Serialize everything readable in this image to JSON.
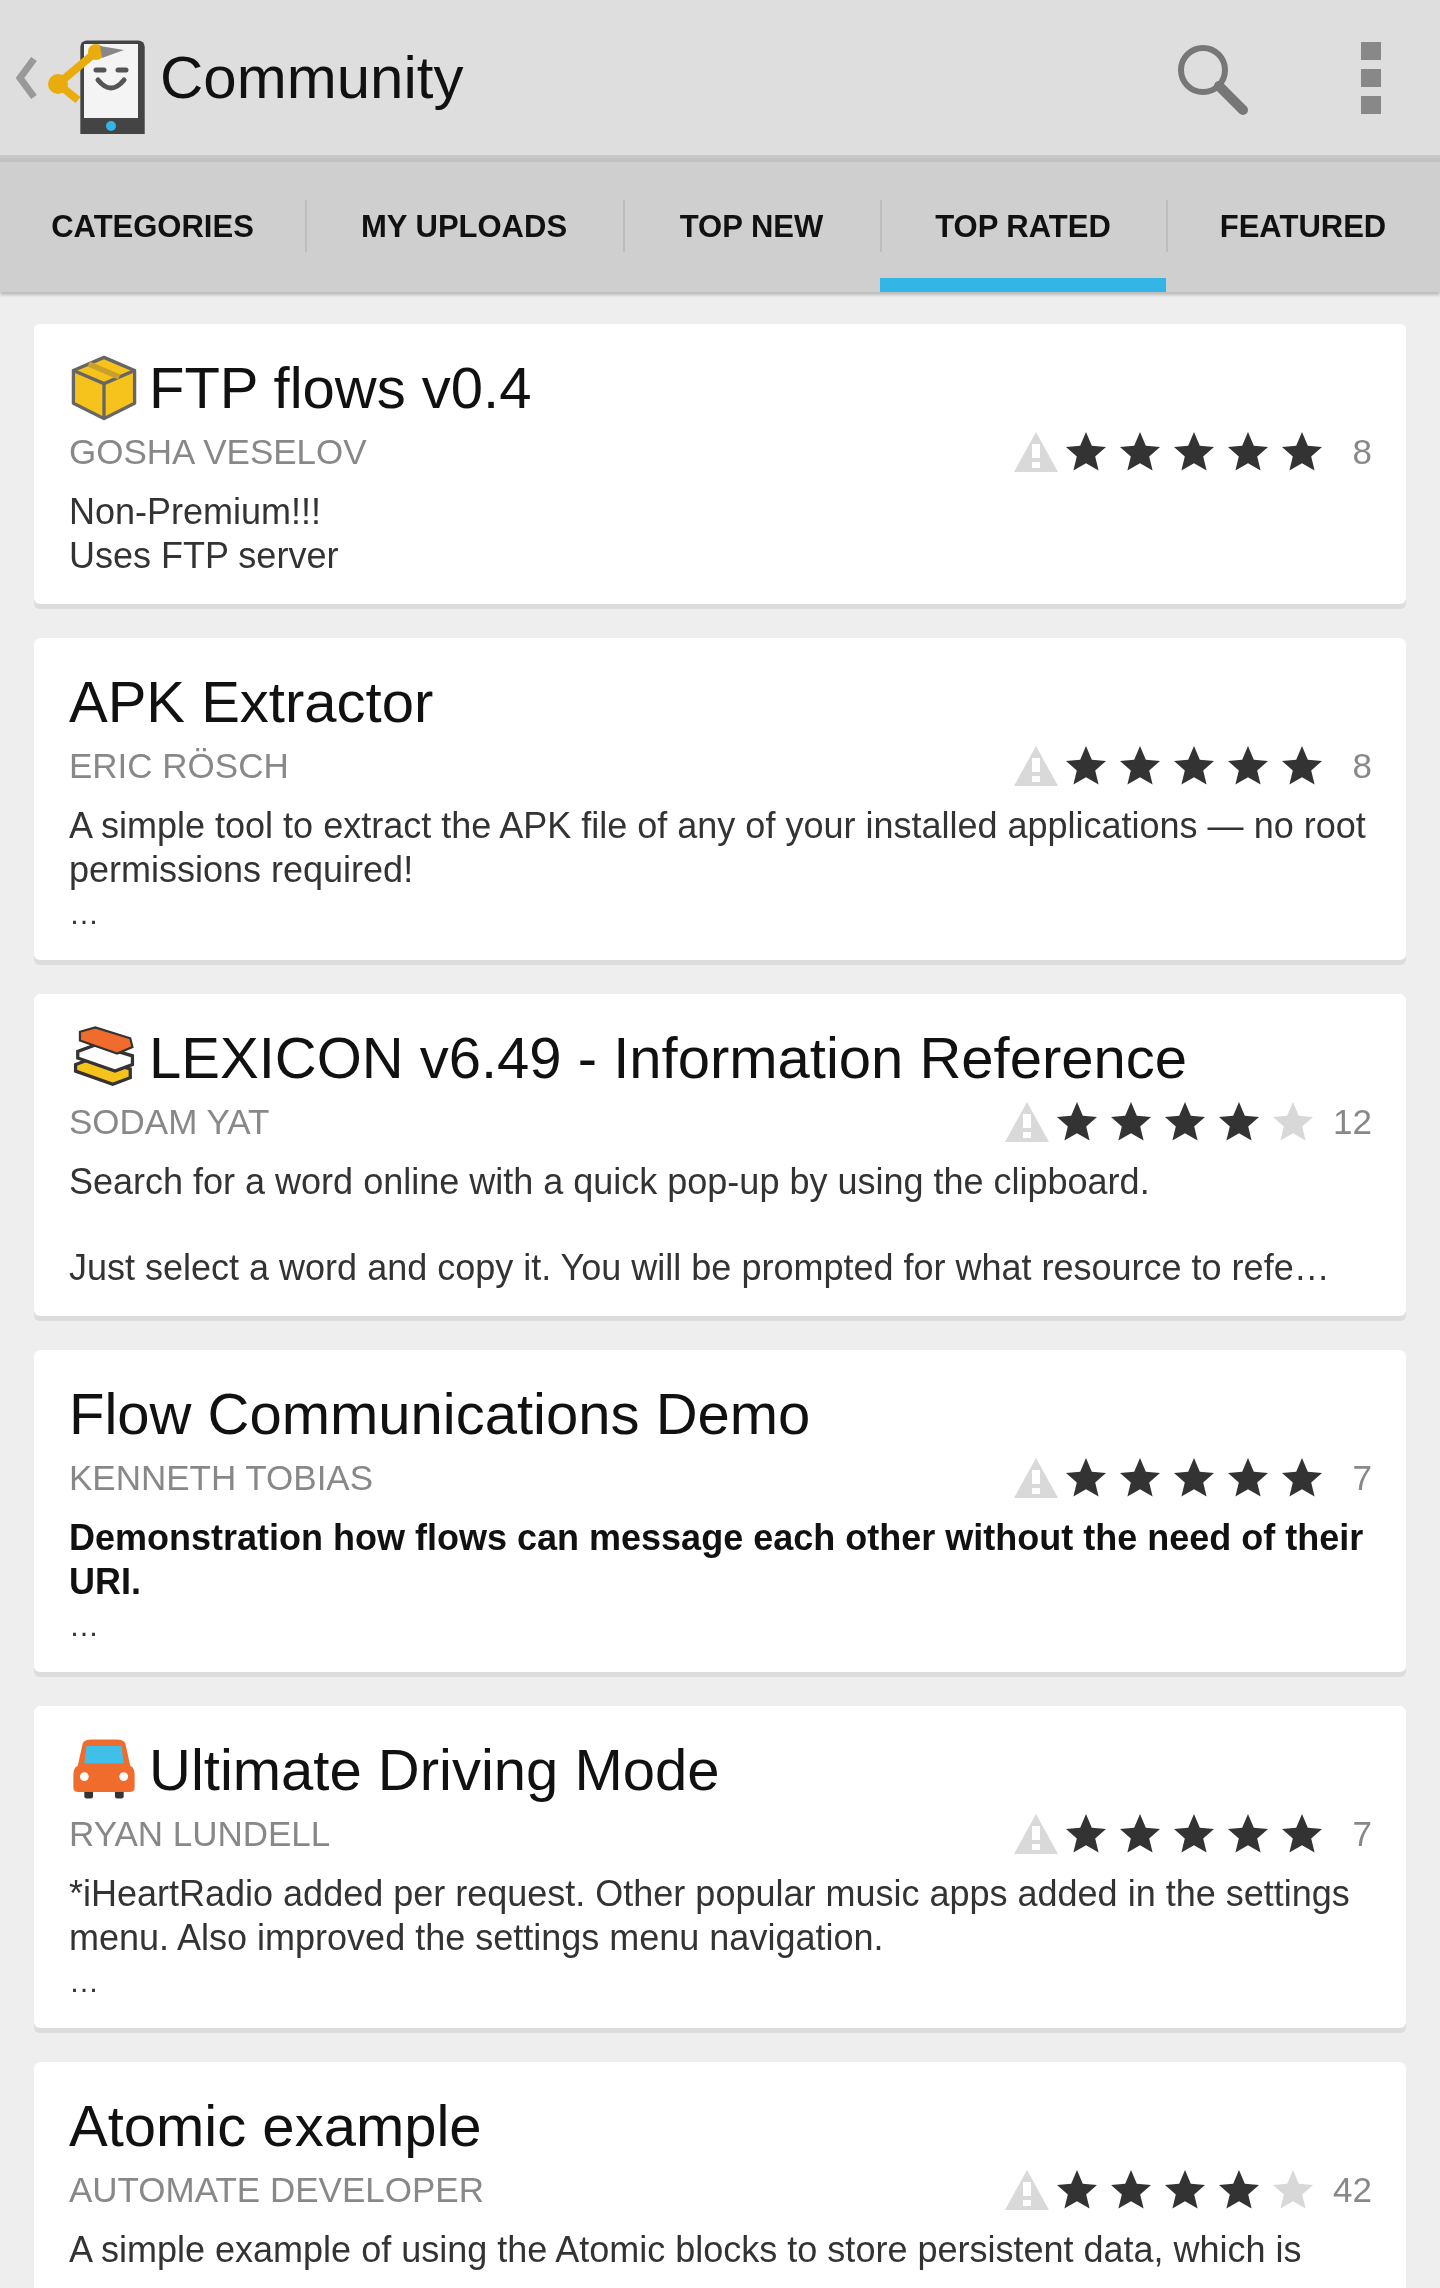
{
  "app_bar": {
    "title": "Community"
  },
  "tabs": [
    {
      "label": "CATEGORIES",
      "selected": false
    },
    {
      "label": "MY UPLOADS",
      "selected": false
    },
    {
      "label": "TOP NEW",
      "selected": false
    },
    {
      "label": "TOP RATED",
      "selected": true
    },
    {
      "label": "FEATURED",
      "selected": false
    }
  ],
  "flows": [
    {
      "kind": "box",
      "title": "FTP flows v0.4",
      "author": "GOSHA VESELOV",
      "stars": 5,
      "count": "8",
      "bold": false,
      "description": [
        "Non-Premium!!!\nUses FTP server"
      ]
    },
    {
      "title": "APK Extractor",
      "author": "ERIC RÖSCH",
      "stars": 5,
      "count": "8",
      "bold": false,
      "description": [
        "A simple tool to extract the APK file of any of your installed applications — no root permissions required!"
      ],
      "more": "…"
    },
    {
      "kind": "books",
      "title": "LEXICON v6.49 - Information Reference",
      "author": "SODAM YAT",
      "stars": 4,
      "count": "12",
      "bold": false,
      "description": [
        "Search for a word online with a quick pop-up by using the clipboard.",
        "Just select a word and copy it. You will be prompted for what resource to refe…"
      ]
    },
    {
      "title": "Flow Communications Demo",
      "author": "KENNETH TOBIAS",
      "stars": 5,
      "count": "7",
      "bold": true,
      "description": [
        "Demonstration how flows can message each other without the need of their URI."
      ],
      "more": "…"
    },
    {
      "kind": "car",
      "title": "Ultimate Driving Mode",
      "author": "RYAN LUNDELL",
      "stars": 5,
      "count": "7",
      "bold": false,
      "description": [
        "*iHeartRadio added per request. Other popular music apps added in the settings menu. Also improved the settings menu navigation."
      ],
      "more": "…"
    },
    {
      "title": "Atomic example",
      "author": "AUTOMATE DEVELOPER",
      "stars": 4,
      "count": "42",
      "bold": false,
      "description": [
        "A simple example of using the Atomic blocks to store persistent data, which is"
      ]
    }
  ]
}
